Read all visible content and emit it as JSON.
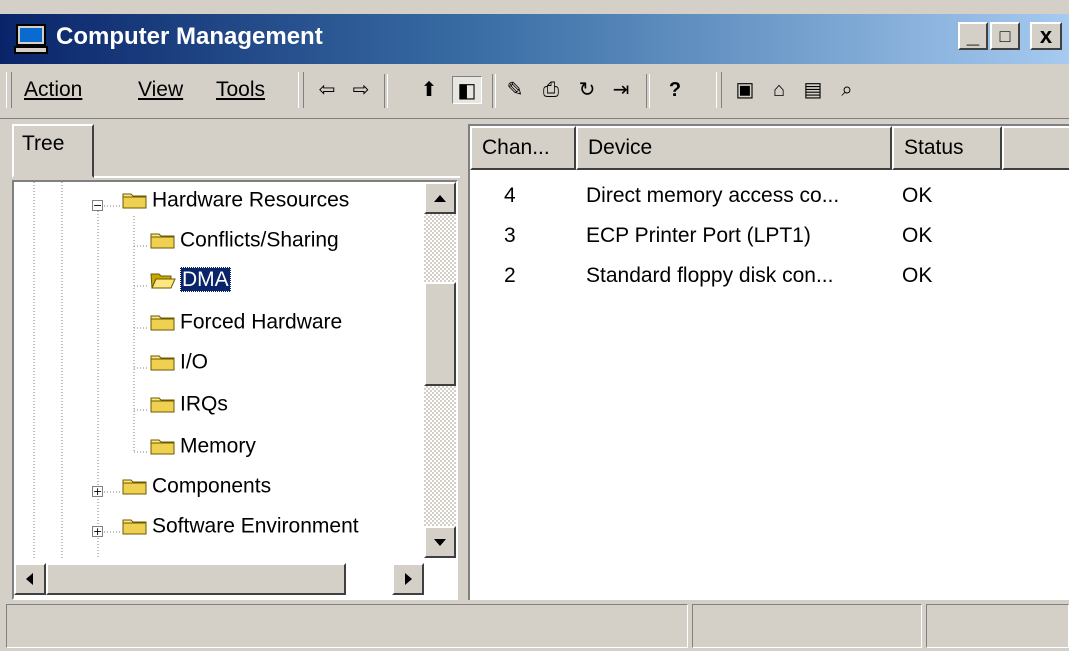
{
  "window": {
    "title": "Computer Management",
    "icon": "computer-monitor-icon",
    "controls": {
      "minimize": "_",
      "maximize": "□",
      "close": "x"
    }
  },
  "menu": {
    "items": [
      "Action",
      "View",
      "Tools"
    ]
  },
  "toolbar": {
    "buttons": [
      {
        "icon": "back-arrow-icon",
        "glyph": "⇦"
      },
      {
        "icon": "forward-arrow-icon",
        "glyph": "⇨"
      },
      {
        "icon": "up-one-level-icon",
        "glyph": "⬆"
      },
      {
        "icon": "show-hide-tree-icon",
        "glyph": "◧",
        "pressed": true
      },
      {
        "icon": "properties-icon",
        "glyph": "✎"
      },
      {
        "icon": "print-icon",
        "glyph": "⎙"
      },
      {
        "icon": "refresh-icon",
        "glyph": "↻"
      },
      {
        "icon": "export-list-icon",
        "glyph": "⇥"
      },
      {
        "icon": "help-icon",
        "glyph": "?"
      },
      {
        "icon": "save-icon",
        "glyph": "▣"
      },
      {
        "icon": "open-icon",
        "glyph": "⌂"
      },
      {
        "icon": "file-icon",
        "glyph": "▤"
      },
      {
        "icon": "find-icon",
        "glyph": "⌕"
      }
    ]
  },
  "tree": {
    "tab_label": "Tree",
    "items": [
      {
        "label": "Hardware Resources",
        "level": 0,
        "expander": "minus",
        "selected": false
      },
      {
        "label": "Conflicts/Sharing",
        "level": 1,
        "selected": false
      },
      {
        "label": "DMA",
        "level": 1,
        "selected": true,
        "open": true
      },
      {
        "label": "Forced Hardware",
        "level": 1,
        "selected": false
      },
      {
        "label": "I/O",
        "level": 1,
        "selected": false
      },
      {
        "label": "IRQs",
        "level": 1,
        "selected": false
      },
      {
        "label": "Memory",
        "level": 1,
        "selected": false
      },
      {
        "label": "Components",
        "level": 0,
        "expander": "plus",
        "selected": false
      },
      {
        "label": "Software Environment",
        "level": 0,
        "expander": "plus",
        "selected": false
      }
    ]
  },
  "list": {
    "columns": [
      "Chan...",
      "Device",
      "Status"
    ],
    "rows": [
      {
        "channel": "4",
        "device": "Direct memory access co...",
        "status": "OK"
      },
      {
        "channel": "3",
        "device": "ECP Printer Port (LPT1)",
        "status": "OK"
      },
      {
        "channel": "2",
        "device": "Standard floppy disk con...",
        "status": "OK"
      }
    ]
  },
  "statusbar": {
    "panes": [
      "",
      "",
      ""
    ]
  }
}
